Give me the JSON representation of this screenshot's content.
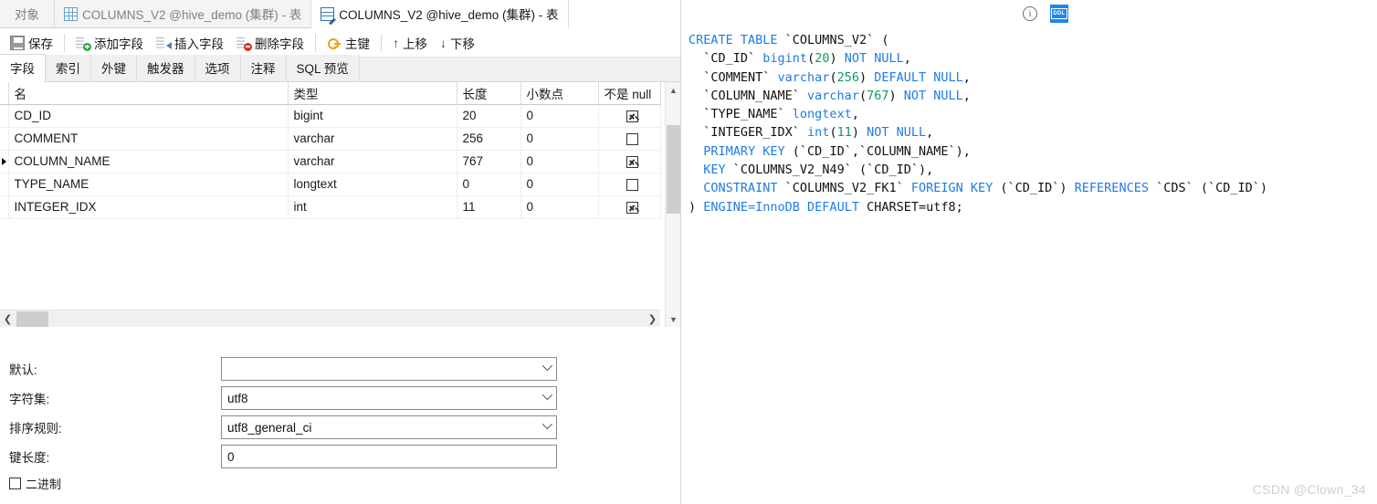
{
  "window_tabs": [
    {
      "label": "对象",
      "icon": null,
      "selected": false
    },
    {
      "label": "COLUMNS_V2 @hive_demo (集群) - 表",
      "icon": "grid-icon",
      "selected": false
    },
    {
      "label": "COLUMNS_V2 @hive_demo (集群) - 表",
      "icon": "grid-edit-icon",
      "selected": true
    }
  ],
  "toolbar": {
    "save": "保存",
    "add_field": "添加字段",
    "insert_field": "插入字段",
    "delete_field": "删除字段",
    "primary_key": "主键",
    "move_up": "上移",
    "move_down": "下移",
    "up_arrow": "↑",
    "down_arrow": "↓"
  },
  "inner_tabs": [
    {
      "label": "字段",
      "selected": true
    },
    {
      "label": "索引",
      "selected": false
    },
    {
      "label": "外键",
      "selected": false
    },
    {
      "label": "触发器",
      "selected": false
    },
    {
      "label": "选项",
      "selected": false
    },
    {
      "label": "注释",
      "selected": false
    },
    {
      "label": "SQL 预览",
      "selected": false
    }
  ],
  "grid": {
    "columns": [
      "名",
      "类型",
      "长度",
      "小数点",
      "不是 null"
    ],
    "rows": [
      {
        "selected": false,
        "name": "CD_ID",
        "type": "bigint",
        "length": "20",
        "decimals": "0",
        "not_null": true
      },
      {
        "selected": false,
        "name": "COMMENT",
        "type": "varchar",
        "length": "256",
        "decimals": "0",
        "not_null": false
      },
      {
        "selected": true,
        "name": "COLUMN_NAME",
        "type": "varchar",
        "length": "767",
        "decimals": "0",
        "not_null": true
      },
      {
        "selected": false,
        "name": "TYPE_NAME",
        "type": "longtext",
        "length": "0",
        "decimals": "0",
        "not_null": false
      },
      {
        "selected": false,
        "name": "INTEGER_IDX",
        "type": "int",
        "length": "11",
        "decimals": "0",
        "not_null": true
      }
    ]
  },
  "form": {
    "fields": [
      {
        "label": "默认:",
        "value": "",
        "control": "combobox"
      },
      {
        "label": "字符集:",
        "value": "utf8",
        "control": "combobox"
      },
      {
        "label": "排序规则:",
        "value": "utf8_general_ci",
        "control": "combobox"
      },
      {
        "label": "键长度:",
        "value": "0",
        "control": "textbox"
      }
    ],
    "checkbox": {
      "label": "二进制",
      "checked": false
    }
  },
  "right_panel": {
    "info_icon_glyph": "i",
    "ddl_label": "DDL",
    "sql_lines": [
      [
        {
          "t": "CREATE TABLE ",
          "c": "kw"
        },
        {
          "t": "`COLUMNS_V2` (",
          "c": "plain"
        }
      ],
      [
        {
          "t": "  `CD_ID` ",
          "c": "plain"
        },
        {
          "t": "bigint",
          "c": "kw"
        },
        {
          "t": "(",
          "c": "plain"
        },
        {
          "t": "20",
          "c": "num"
        },
        {
          "t": ") ",
          "c": "plain"
        },
        {
          "t": "NOT NULL",
          "c": "kw"
        },
        {
          "t": ",",
          "c": "plain"
        }
      ],
      [
        {
          "t": "  `COMMENT` ",
          "c": "plain"
        },
        {
          "t": "varchar",
          "c": "kw"
        },
        {
          "t": "(",
          "c": "plain"
        },
        {
          "t": "256",
          "c": "num"
        },
        {
          "t": ") ",
          "c": "plain"
        },
        {
          "t": "DEFAULT NULL",
          "c": "kw"
        },
        {
          "t": ",",
          "c": "plain"
        }
      ],
      [
        {
          "t": "  `COLUMN_NAME` ",
          "c": "plain"
        },
        {
          "t": "varchar",
          "c": "kw"
        },
        {
          "t": "(",
          "c": "plain"
        },
        {
          "t": "767",
          "c": "num"
        },
        {
          "t": ") ",
          "c": "plain"
        },
        {
          "t": "NOT NULL",
          "c": "kw"
        },
        {
          "t": ",",
          "c": "plain"
        }
      ],
      [
        {
          "t": "  `TYPE_NAME` ",
          "c": "plain"
        },
        {
          "t": "longtext",
          "c": "kw"
        },
        {
          "t": ",",
          "c": "plain"
        }
      ],
      [
        {
          "t": "  `INTEGER_IDX` ",
          "c": "plain"
        },
        {
          "t": "int",
          "c": "kw"
        },
        {
          "t": "(",
          "c": "plain"
        },
        {
          "t": "11",
          "c": "num"
        },
        {
          "t": ") ",
          "c": "plain"
        },
        {
          "t": "NOT NULL",
          "c": "kw"
        },
        {
          "t": ",",
          "c": "plain"
        }
      ],
      [
        {
          "t": "  ",
          "c": "plain"
        },
        {
          "t": "PRIMARY KEY",
          "c": "kw"
        },
        {
          "t": " (`CD_ID`,`COLUMN_NAME`),",
          "c": "plain"
        }
      ],
      [
        {
          "t": "  ",
          "c": "plain"
        },
        {
          "t": "KEY",
          "c": "kw"
        },
        {
          "t": " `COLUMNS_V2_N49` (`CD_ID`),",
          "c": "plain"
        }
      ],
      [
        {
          "t": "  ",
          "c": "plain"
        },
        {
          "t": "CONSTRAINT",
          "c": "kw"
        },
        {
          "t": " `COLUMNS_V2_FK1` ",
          "c": "plain"
        },
        {
          "t": "FOREIGN KEY",
          "c": "kw"
        },
        {
          "t": " (`CD_ID`) ",
          "c": "plain"
        },
        {
          "t": "REFERENCES",
          "c": "kw"
        },
        {
          "t": " `CDS` (`CD_ID`)",
          "c": "plain"
        }
      ],
      [
        {
          "t": ") ",
          "c": "plain"
        },
        {
          "t": "ENGINE=InnoDB DEFAULT",
          "c": "kw"
        },
        {
          "t": " CHARSET=utf8;",
          "c": "plain"
        }
      ]
    ]
  },
  "watermark": "CSDN @Clown_34",
  "colors": {
    "accent_blue": "#1e87f0",
    "keyword_blue": "#1e7be8",
    "number_green": "#0f9d58",
    "key_gold": "#e8a317",
    "add_green": "#2fa64f",
    "delete_red": "#d93025"
  }
}
